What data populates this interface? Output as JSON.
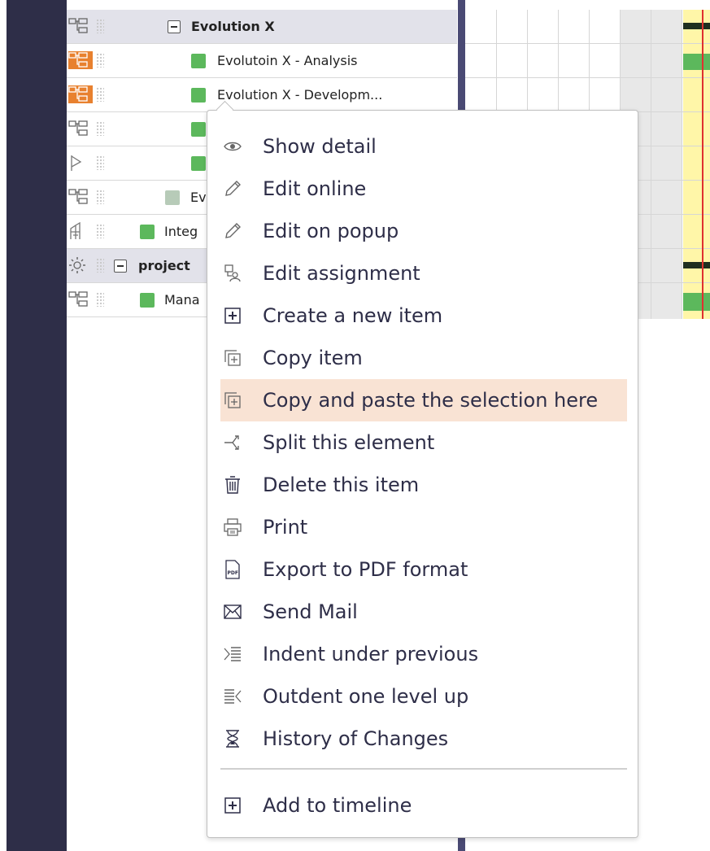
{
  "rows": [
    {
      "label": "Evolution X",
      "type": "group"
    },
    {
      "label": "Evolutoin X - Analysis",
      "type": "task"
    },
    {
      "label": "Evolution X - Developm...",
      "type": "task"
    },
    {
      "label": "",
      "type": "task"
    },
    {
      "label": "",
      "type": "milestone"
    },
    {
      "label": "Ev",
      "type": "task"
    },
    {
      "label": "Integ",
      "type": "task"
    },
    {
      "label": "project",
      "type": "group"
    },
    {
      "label": "Mana",
      "type": "task"
    }
  ],
  "menu": {
    "items": [
      {
        "label": "Show detail",
        "icon": "eye-icon"
      },
      {
        "label": "Edit online",
        "icon": "pencil-icon"
      },
      {
        "label": "Edit on popup",
        "icon": "pencil-icon"
      },
      {
        "label": "Edit assignment",
        "icon": "assignment-icon"
      },
      {
        "label": "Create a new item",
        "icon": "plus-box-icon"
      },
      {
        "label": "Copy item",
        "icon": "copy-icon"
      },
      {
        "label": "Copy and paste the selection here",
        "icon": "copy-paste-icon",
        "highlighted": true
      },
      {
        "label": "Split this element",
        "icon": "split-icon"
      },
      {
        "label": "Delete this item",
        "icon": "trash-icon"
      },
      {
        "label": "Print",
        "icon": "printer-icon"
      },
      {
        "label": "Export to PDF format",
        "icon": "pdf-icon"
      },
      {
        "label": "Send Mail",
        "icon": "mail-icon"
      },
      {
        "label": "Indent under previous",
        "icon": "indent-icon"
      },
      {
        "label": "Outdent one level up",
        "icon": "outdent-icon"
      },
      {
        "label": "History of Changes",
        "icon": "hourglass-icon"
      }
    ],
    "timeline_item": {
      "label": "Add to timeline",
      "icon": "plus-box-icon"
    }
  },
  "colors": {
    "sidebar": "#2e2e48",
    "menu_text": "#2e2e48",
    "highlight": "#f9e3d4",
    "task_green": "#5cb85c",
    "orange_icon": "#e8812f",
    "today_line": "#e03030"
  }
}
